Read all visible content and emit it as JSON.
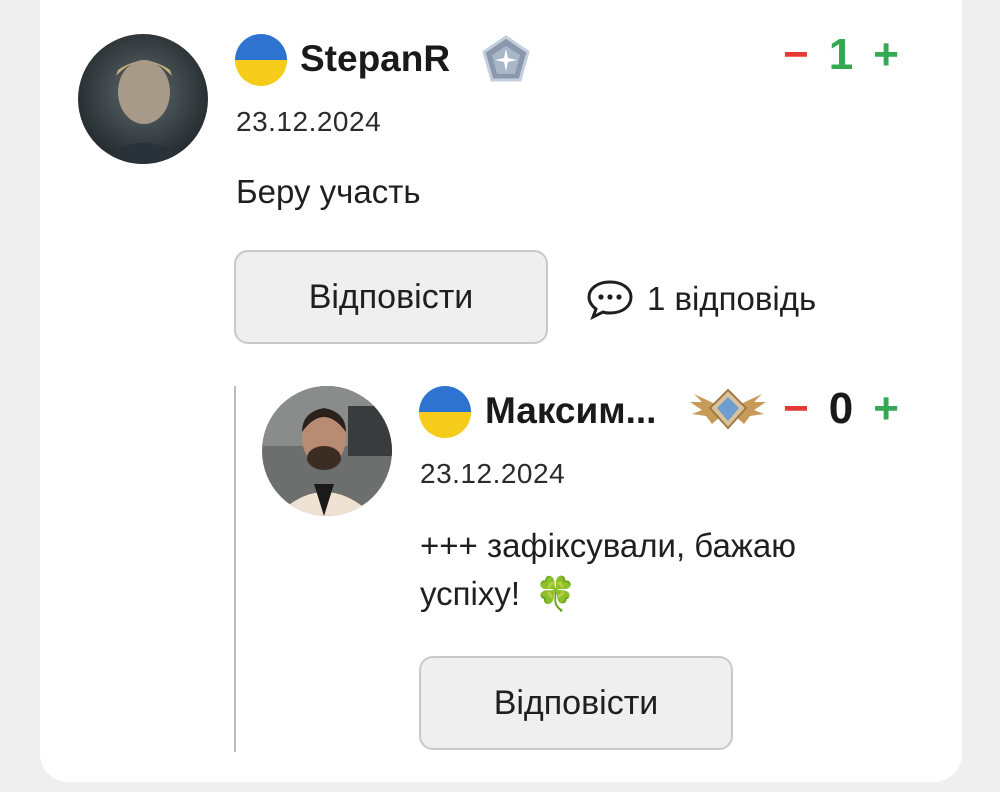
{
  "comment": {
    "username": "StepanR",
    "date": "23.12.2024",
    "text": "Беру участь",
    "vote_minus": "−",
    "vote_count": "1",
    "vote_plus": "+",
    "reply_label": "Відповісти",
    "replies_count_label": "1 відповідь",
    "flag": "ukraine-flag-icon",
    "rank_badge": "star-rank-badge-icon"
  },
  "reply": {
    "username": "Максим...",
    "date": "23.12.2024",
    "text_line1": "+++ зафіксували, бажаю",
    "text_line2": "успіху!",
    "emoji": "🍀",
    "vote_minus": "−",
    "vote_count": "0",
    "vote_plus": "+",
    "reply_label": "Відповісти",
    "flag": "ukraine-flag-icon",
    "rank_badge": "winged-rank-badge-icon"
  },
  "colors": {
    "minus": "#e53935",
    "plus": "#34a853",
    "count_positive": "#34a853",
    "count_zero": "#1a1a1a",
    "flag_blue": "#2f73d0",
    "flag_yellow": "#f5cc1a"
  }
}
